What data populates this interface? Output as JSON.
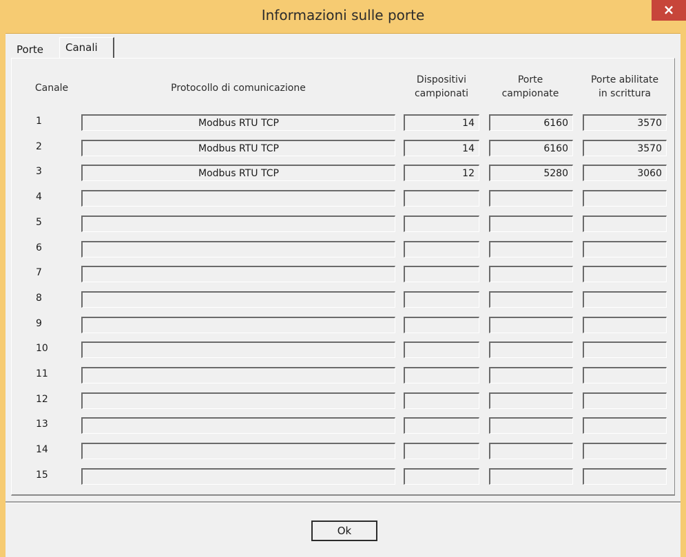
{
  "window": {
    "title": "Informazioni sulle porte",
    "close_label": "×"
  },
  "tabs": [
    {
      "label": "Porte"
    },
    {
      "label": "Canali"
    }
  ],
  "table": {
    "headers": {
      "canale": "Canale",
      "protocollo": "Protocollo di comunicazione",
      "dispositivi_line1": "Dispositivi",
      "dispositivi_line2": "campionati",
      "porte_line1": "Porte",
      "porte_line2": "campionate",
      "abilitate_line1": "Porte abilitate",
      "abilitate_line2": "in scrittura"
    },
    "rows": [
      {
        "canale": "1",
        "protocollo": "Modbus RTU TCP",
        "dispositivi": "14",
        "porte": "6160",
        "abilitate": "3570"
      },
      {
        "canale": "2",
        "protocollo": "Modbus RTU TCP",
        "dispositivi": "14",
        "porte": "6160",
        "abilitate": "3570"
      },
      {
        "canale": "3",
        "protocollo": "Modbus RTU TCP",
        "dispositivi": "12",
        "porte": "5280",
        "abilitate": "3060"
      },
      {
        "canale": "4",
        "protocollo": "",
        "dispositivi": "",
        "porte": "",
        "abilitate": ""
      },
      {
        "canale": "5",
        "protocollo": "",
        "dispositivi": "",
        "porte": "",
        "abilitate": ""
      },
      {
        "canale": "6",
        "protocollo": "",
        "dispositivi": "",
        "porte": "",
        "abilitate": ""
      },
      {
        "canale": "7",
        "protocollo": "",
        "dispositivi": "",
        "porte": "",
        "abilitate": ""
      },
      {
        "canale": "8",
        "protocollo": "",
        "dispositivi": "",
        "porte": "",
        "abilitate": ""
      },
      {
        "canale": "9",
        "protocollo": "",
        "dispositivi": "",
        "porte": "",
        "abilitate": ""
      },
      {
        "canale": "10",
        "protocollo": "",
        "dispositivi": "",
        "porte": "",
        "abilitate": ""
      },
      {
        "canale": "11",
        "protocollo": "",
        "dispositivi": "",
        "porte": "",
        "abilitate": ""
      },
      {
        "canale": "12",
        "protocollo": "",
        "dispositivi": "",
        "porte": "",
        "abilitate": ""
      },
      {
        "canale": "13",
        "protocollo": "",
        "dispositivi": "",
        "porte": "",
        "abilitate": ""
      },
      {
        "canale": "14",
        "protocollo": "",
        "dispositivi": "",
        "porte": "",
        "abilitate": ""
      },
      {
        "canale": "15",
        "protocollo": "",
        "dispositivi": "",
        "porte": "",
        "abilitate": ""
      }
    ]
  },
  "footer": {
    "ok_label": "Ok"
  },
  "colors": {
    "titlebar": "#f6cb72",
    "close": "#c7453a",
    "dialog_bg": "#f0f0f0"
  }
}
